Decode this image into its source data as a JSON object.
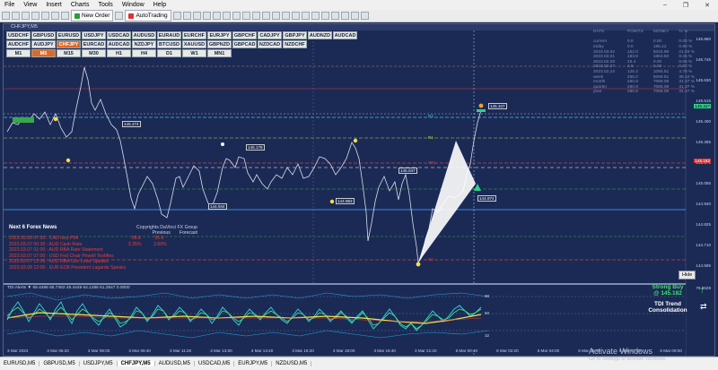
{
  "menu": [
    "File",
    "View",
    "Insert",
    "Charts",
    "Tools",
    "Window",
    "Help"
  ],
  "toolbar": {
    "new_order": "New Order",
    "autotrading": "AutoTrading"
  },
  "chart_title": "CHFJPY,M5",
  "symbols_row1": [
    "USDCHF",
    "GBPUSD",
    "EURUSD",
    "USDJPY",
    "USDCAD",
    "AUDUSD",
    "EURAUD",
    "EURCHF",
    "EURJPY",
    "GBPCHF",
    "CADJPY",
    "GBPJPY",
    "AUDNZD",
    "AUDCAD"
  ],
  "symbols_row2": [
    "AUDCHF",
    "AUDJPY",
    "CHFJPY",
    "EURCAD",
    "AUDCAD",
    "NZDJPY",
    "BTCUSD",
    "XAUUSD",
    "GBPNZD",
    "GBPCAD",
    "NZDCAD",
    "NZDCHF"
  ],
  "timeframes": [
    "M1",
    "M5",
    "M15",
    "M30",
    "H1",
    "H4",
    "D1",
    "W1",
    "MN1"
  ],
  "active_symbol": "CHFJPY",
  "active_tf": "M5",
  "stats": {
    "headers": [
      "DATE",
      "POINTS",
      "MONEY",
      "% %"
    ],
    "rows": [
      [
        "current",
        "0.0",
        "0.00",
        "0.00 %"
      ],
      [
        "today",
        "0.0",
        "196.12",
        "0.90 %"
      ],
      [
        "2023.03.02",
        "152.0",
        "5034.96",
        "21.83 %"
      ],
      [
        "2023.03.01",
        "183.8",
        "1863.50",
        "8.25 %"
      ],
      [
        "2023.02.28",
        "25.4",
        "0.00",
        "0.06 %"
      ],
      [
        "2023.02.27",
        "2.8",
        "0.00",
        "0.00 %"
      ],
      [
        "2023.02.24",
        "125.2",
        "1095.81",
        "4.78 %"
      ],
      [
        "week",
        "265.0",
        "5069.51",
        "39.10 %"
      ],
      [
        "month",
        "280.9",
        "7088.08",
        "31.37 %"
      ],
      [
        "quarter",
        "280.9",
        "7088.08",
        "31.37 %"
      ],
      [
        "year",
        "280.9",
        "7088.08",
        "31.37 %"
      ]
    ]
  },
  "news": {
    "title": "Next 6 Forex News",
    "credit": "Copyrights DaVinci FX Group",
    "col_prev": "Previous",
    "col_fore": "Forecast",
    "items": [
      {
        "text": "2023.03.06 07:30 : CAD Ivey PMI",
        "prev": "58.6",
        "fore": "55.9"
      },
      {
        "text": "2023.03.07 00:30 : AUD Cash Rate",
        "prev": "3.35%",
        "fore": "3.60%"
      },
      {
        "text": "2023.03.07 01:00 : AUD RBA Rate Statement",
        "prev": "",
        "fore": ""
      },
      {
        "text": "2023.03.07 07:00 : USD Fed Chair Powell Testifies",
        "prev": "",
        "fore": ""
      },
      {
        "text": "2023.03.07 12:00 : AUD RBA Gov Lowe Speaks",
        "prev": "",
        "fore": ""
      },
      {
        "text": "2023.03.08 12:00 : EUR ECB President Lagarde Speaks",
        "prev": "",
        "fore": ""
      }
    ]
  },
  "price_levels": [
    "145.860",
    "145.745",
    "145.630",
    "145.515",
    "145.400",
    "145.285",
    "145.170",
    "145.055",
    "144.940",
    "144.825",
    "144.710",
    "144.595"
  ],
  "chart_tags": {
    "p1": "145.274",
    "p2": "145.178",
    "p3": "145.347",
    "p4": "144.953",
    "p5": "144.944",
    "p6": "144.974",
    "p7": "145.047",
    "pivot": "SR1",
    "s2": "S2",
    "r1": "R1",
    "r2": "R2"
  },
  "right_labels": {
    "l1": "145.347",
    "l2": "145.182"
  },
  "tdi": {
    "title": "TDI Alerts ▼ 69.4486 65.7492 49.4449 64.1286 61.2647 0.0000",
    "signal": "Strong Buy",
    "value": "@ 145.182",
    "trend_label": "TDI Trend",
    "trend_value": "Consolidation",
    "levels": [
      "76.8528",
      "68",
      "50",
      "32"
    ]
  },
  "hide_label": "Hide",
  "time_axis": [
    "3 Mar 2023",
    "3 Mar 06:20",
    "3 Mar 08:00",
    "3 Mar 09:40",
    "3 Mar 11:20",
    "3 Mar 13:00",
    "3 Mar 14:40",
    "3 Mar 16:20",
    "3 Mar 18:00",
    "3 Mar 19:40",
    "3 Mar 21:20",
    "6 Mar 00:40",
    "6 Mar 02:20",
    "6 Mar 04:00",
    "6 Mar 05:40",
    "6 Mar 07:20",
    "6 Mar 09:00"
  ],
  "tabs": [
    "EURUSD,M5",
    "GBPUSD,M5",
    "USDJPY,M5",
    "CHFJPY,M5",
    "AUDUSD,M5",
    "USDCAD,M5",
    "EURJPY,M5",
    "NZDUSD,M5"
  ],
  "active_tab": "CHFJPY,M5",
  "watermark": {
    "title": "Activate Windows",
    "sub": "Go to Settings to activate Windows."
  }
}
